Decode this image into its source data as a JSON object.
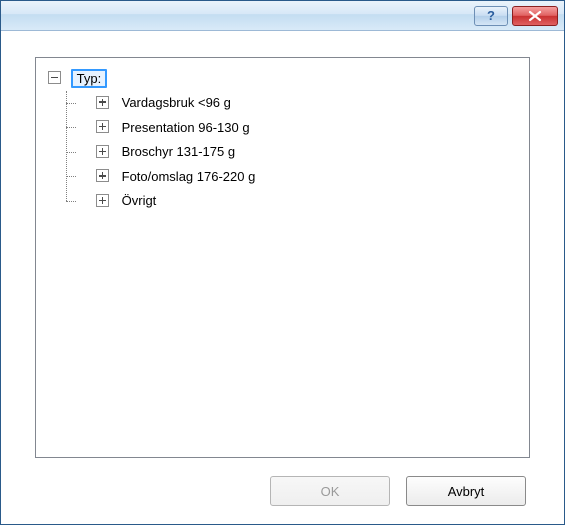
{
  "titlebar": {
    "help_glyph": "?",
    "close_glyph": "×"
  },
  "tree": {
    "root": {
      "label": "Typ:",
      "expanded": true,
      "selected": true,
      "children": [
        {
          "label": "Vardagsbruk <96 g"
        },
        {
          "label": "Presentation 96-130 g"
        },
        {
          "label": "Broschyr 131-175 g"
        },
        {
          "label": "Foto/omslag 176-220 g"
        },
        {
          "label": "Övrigt"
        }
      ]
    }
  },
  "buttons": {
    "ok": "OK",
    "cancel": "Avbryt"
  }
}
